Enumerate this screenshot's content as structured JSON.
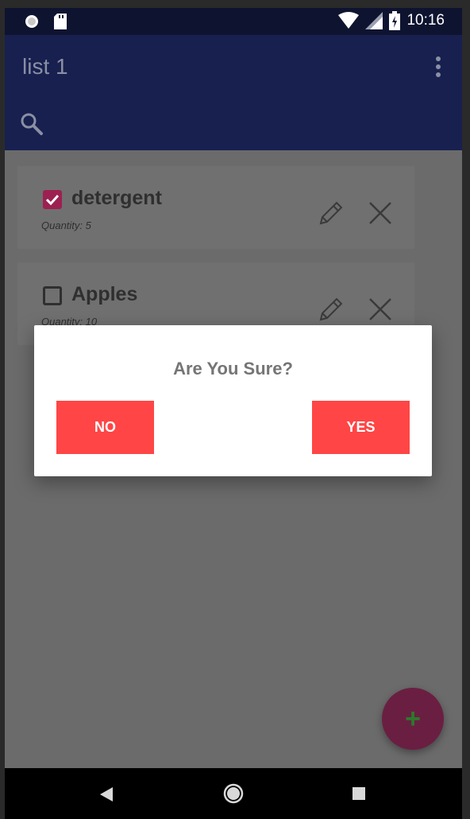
{
  "status_bar": {
    "time": "10:16",
    "icons": [
      "circle-icon",
      "sd-card-icon",
      "wifi-icon",
      "signal-icon",
      "battery-charging-icon"
    ]
  },
  "app_bar": {
    "title": "list 1",
    "icons": [
      "overflow-menu-icon",
      "search-icon"
    ]
  },
  "items": [
    {
      "name": "detergent",
      "quantity": "Quantity: 5",
      "checked": true
    },
    {
      "name": "Apples",
      "quantity": "Quantity: 10",
      "checked": false
    }
  ],
  "dialog": {
    "title": "Are You Sure?",
    "no_label": "NO",
    "yes_label": "YES"
  },
  "fab": {
    "label": "+"
  },
  "nav_bar": {
    "icons": [
      "back-icon",
      "home-icon",
      "recents-icon"
    ]
  },
  "colors": {
    "app_bar": "#17204f",
    "status_bar": "#0e1430",
    "accent": "#ff4545",
    "fab": "#6a1f42",
    "checkbox_checked": "#9c2152"
  }
}
